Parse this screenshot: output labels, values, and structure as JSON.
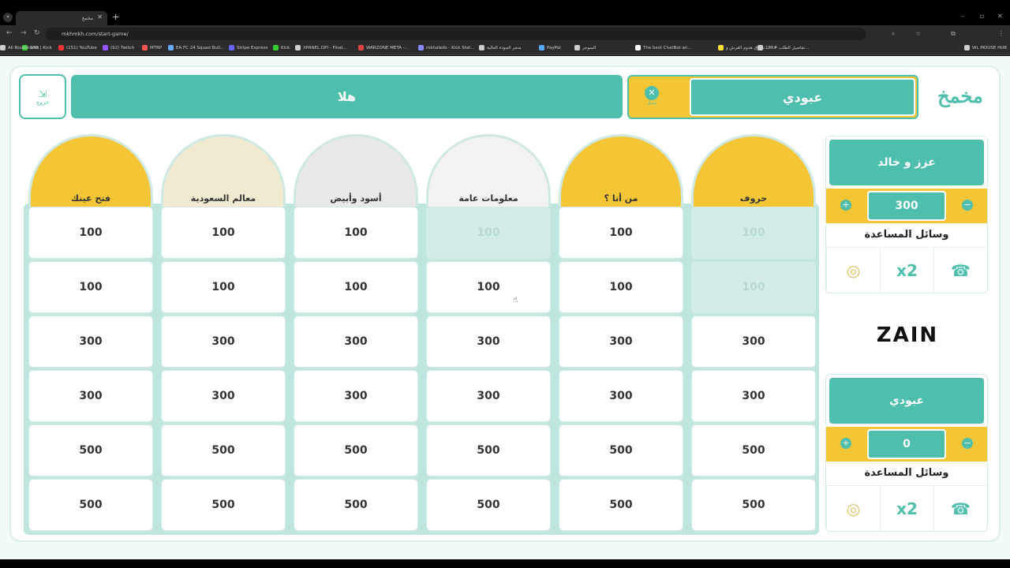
{
  "browser": {
    "tab_title": "مخمخ",
    "url": "mkhmkh.com/start-game/",
    "bookmarks": [
      "SXB | Kick",
      "(151) YouTube",
      "(92) Twitch",
      "MTRP",
      "EA FC 24 Squad Buil...",
      "Stripe Express",
      "Kick",
      "XPANEL DPI - Final...",
      "WARZONE META -...",
      "mkhaleds - Kick Stat...",
      "متجر الجودة العالية",
      "PayPal",
      "السوجر",
      "The best ChatBot an...",
      "تسوق هدوم القرش و...",
      "تفاصيل الطلب #186...",
      "WL MOUSE HUB",
      "All Bookmarks"
    ]
  },
  "header": {
    "exit_label": "خروج",
    "team_bar": "هلا",
    "turn_team": "عبودي",
    "switch_label": "تبديل",
    "logo": "مخمخ"
  },
  "board": {
    "categories": [
      "فتح عينك",
      "معالم السعودية",
      "أسود وأبيض",
      "معلومات عامة",
      "من أنا ؟",
      "حروف"
    ],
    "rows": [
      [
        "100",
        "100",
        "100",
        "100",
        "100",
        "100"
      ],
      [
        "100",
        "100",
        "100",
        "100",
        "100",
        "100"
      ],
      [
        "300",
        "300",
        "300",
        "300",
        "300",
        "300"
      ],
      [
        "300",
        "300",
        "300",
        "300",
        "300",
        "300"
      ],
      [
        "500",
        "500",
        "500",
        "500",
        "500",
        "500"
      ],
      [
        "500",
        "500",
        "500",
        "500",
        "500",
        "500"
      ]
    ],
    "used": [
      [
        0,
        3
      ],
      [
        0,
        5
      ],
      [
        1,
        5
      ]
    ]
  },
  "teams": [
    {
      "name": "عزز و خالد",
      "score": "300",
      "help_title": "وسائل المساعدة",
      "plus": "+",
      "minus": "−"
    },
    {
      "name": "عبودي",
      "score": "0",
      "help_title": "وسائل المساعدة",
      "plus": "+",
      "minus": "−"
    }
  ],
  "sponsor": "ZAIN",
  "colors": {
    "teal": "#4fbfad",
    "yellow": "#f4c534"
  }
}
